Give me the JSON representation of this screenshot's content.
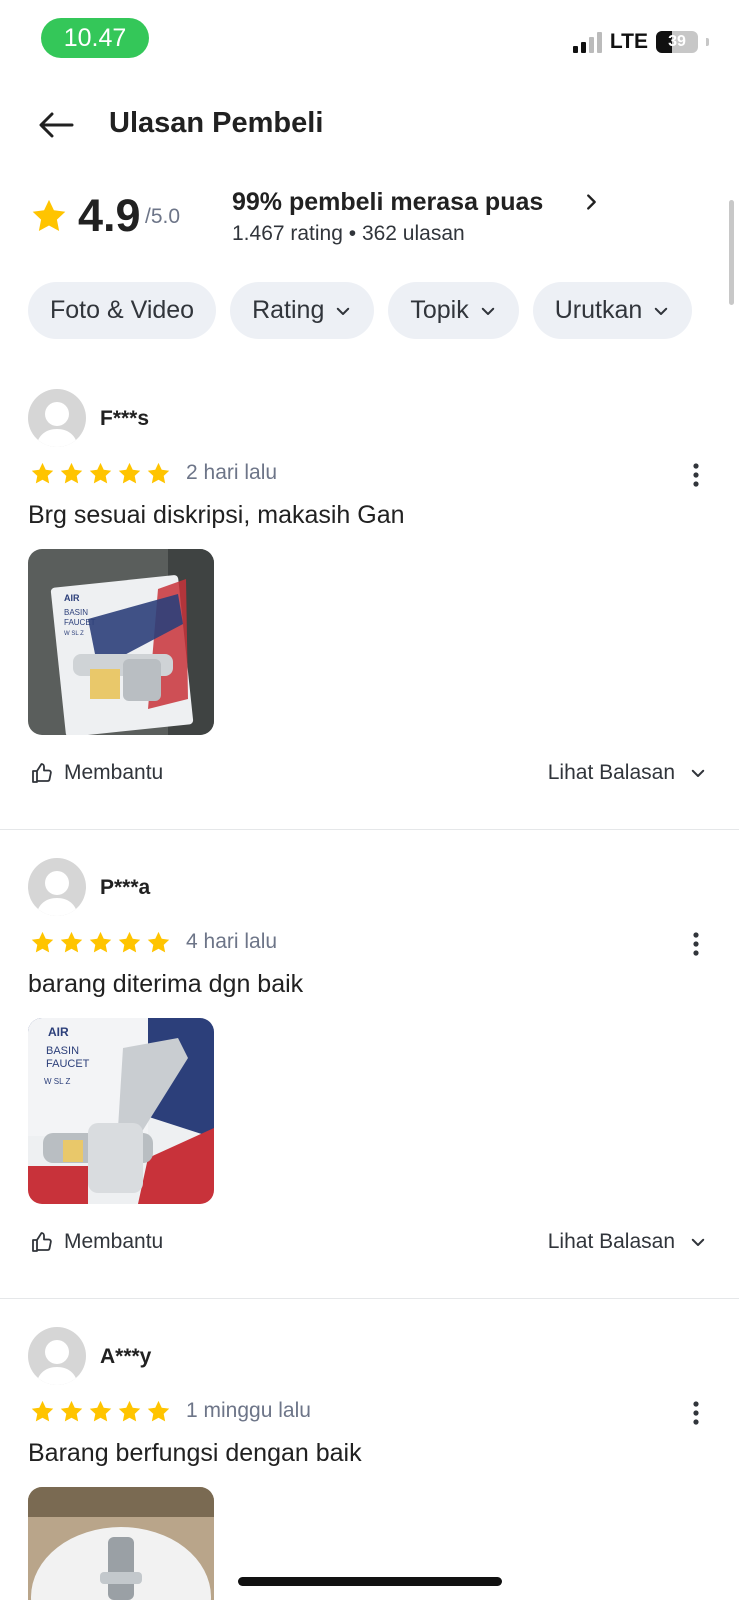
{
  "status_bar": {
    "time": "10.47",
    "network": "LTE",
    "battery": "39"
  },
  "header": {
    "title": "Ulasan Pembeli"
  },
  "summary": {
    "score": "4.9",
    "score_max": "/5.0",
    "satisfied_text": "99% pembeli merasa puas",
    "counts_text": "1.467 rating • 362 ulasan"
  },
  "filters": [
    {
      "label": "Foto & Video",
      "has_dropdown": false
    },
    {
      "label": "Rating",
      "has_dropdown": true
    },
    {
      "label": "Topik",
      "has_dropdown": true
    },
    {
      "label": "Urutkan",
      "has_dropdown": true
    }
  ],
  "reviews": [
    {
      "reviewer": "F***s",
      "rating": 5,
      "date": "2 hari lalu",
      "text": "Brg sesuai diskripsi, makasih Gan",
      "helpful_label": "Membantu",
      "reply_label": "Lihat Balasan",
      "photo_text": [
        "AIR",
        "BASIN",
        "FAUCET",
        "W SL Z"
      ]
    },
    {
      "reviewer": "P***a",
      "rating": 5,
      "date": "4 hari lalu",
      "text": "barang diterima dgn baik",
      "helpful_label": "Membantu",
      "reply_label": "Lihat Balasan",
      "photo_text": [
        "AIR",
        "BASIN",
        "FAUCET",
        "W SL Z"
      ]
    },
    {
      "reviewer": "A***y",
      "rating": 5,
      "date": "1 minggu lalu",
      "text": "Barang berfungsi dengan baik",
      "helpful_label": "Membantu",
      "reply_label": "Lihat Balasan",
      "photo_text": []
    }
  ],
  "colors": {
    "accent_green": "#34c759",
    "star": "#ffc400",
    "chip_bg": "#edf0f5",
    "muted_text": "#6d7588"
  },
  "icons": [
    "back-arrow-icon",
    "star-icon",
    "chevron-right-icon",
    "chevron-down-icon",
    "more-vertical-icon",
    "thumbs-up-icon",
    "avatar-placeholder-icon"
  ]
}
